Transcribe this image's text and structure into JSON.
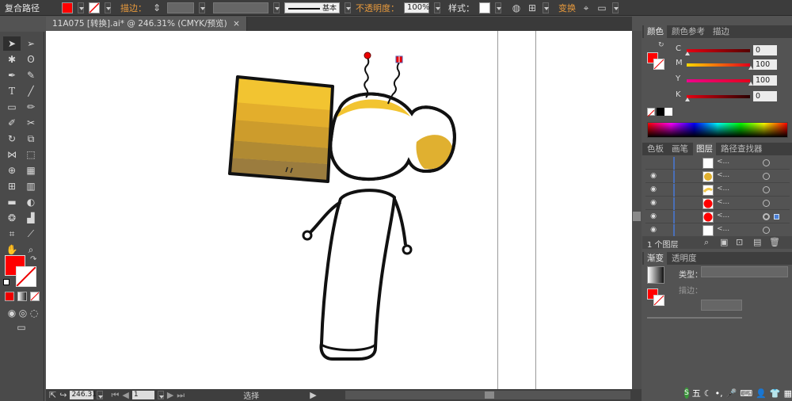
{
  "control_bar": {
    "mode_label": "复合路径",
    "stroke_label": "描边：",
    "stroke_style": "基本",
    "opacity_label": "不透明度：",
    "opacity_value": "100%",
    "style_label": "样式：",
    "transform_label": "变换",
    "fill_color": "#ff0000"
  },
  "document_tab": {
    "title": "11A075 [转换].ai* @ 246.31% (CMYK/预览)"
  },
  "status_bar": {
    "zoom": "246.31",
    "artboard": "1",
    "tool_name": "选择"
  },
  "color_panel": {
    "tabs": [
      "颜色",
      "颜色参考",
      "描边"
    ],
    "channels": [
      {
        "name": "C",
        "value": "0",
        "gradient": "linear-gradient(90deg,#fff,#00aeef)"
      },
      {
        "name": "M",
        "value": "100",
        "gradient": "linear-gradient(90deg,#ffde00,#ec008c)"
      },
      {
        "name": "Y",
        "value": "100",
        "gradient": "linear-gradient(90deg,#ec008c,#e2001a)"
      },
      {
        "name": "K",
        "value": "0",
        "gradient": "linear-gradient(90deg,#e2001a,#3a0000)"
      }
    ],
    "knob_positions": [
      0,
      1,
      1,
      0
    ]
  },
  "layers_panel": {
    "tabs": [
      "色板",
      "画笔",
      "图层",
      "路径查找器"
    ],
    "rows": [
      {
        "eye": "",
        "thumb": "#ffffff",
        "name": "<...",
        "selected": false
      },
      {
        "eye": "◉",
        "thumb": "#e0b030",
        "name": "<...",
        "selected": false
      },
      {
        "eye": "◉",
        "thumb": "#f2c84a",
        "name": "<...",
        "selected": false
      },
      {
        "eye": "◉",
        "thumb": "#ff0000",
        "name": "<...",
        "selected": false
      },
      {
        "eye": "◉",
        "thumb": "#ff0000",
        "name": "<...",
        "selected": true
      },
      {
        "eye": "◉",
        "thumb": "#ffffff",
        "name": "<...",
        "selected": false
      }
    ],
    "footer": "1 个图层"
  },
  "gradient_panel": {
    "tabs": [
      "渐变",
      "透明度"
    ],
    "type_label": "类型：",
    "stroke_label": "描边："
  },
  "colors": {
    "fill": "#ff0000",
    "hair_yellow": "#f2c431",
    "hair_dark": "#d8a62a",
    "hammer_bands": [
      "#f2c431",
      "#e8b42c",
      "#d49c28",
      "#b88a2e",
      "#9a7a3a"
    ]
  },
  "icons": [
    "selection-arrow-icon",
    "direct-selection-icon",
    "pen-icon",
    "type-icon",
    "rectangle-icon",
    "brush-icon",
    "rotate-icon",
    "scale-icon",
    "hand-icon",
    "zoom-icon",
    "eye-icon"
  ]
}
